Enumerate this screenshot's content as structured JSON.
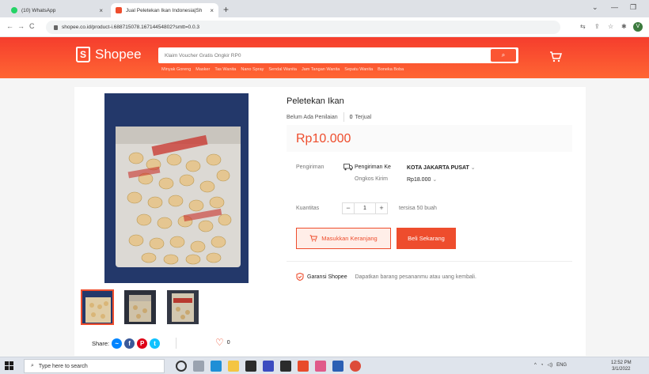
{
  "browser": {
    "tabs": [
      {
        "label": "(10) WhatsApp",
        "icon": "whatsapp-icon",
        "color": "#25d366"
      },
      {
        "label": "Jual Peletekan Ikan Indonesia|Sh",
        "icon": "shopee-bag-icon",
        "color": "#ee4d2d"
      }
    ],
    "url": "shopee.co.id/product-i.688715078.16714454802?smtt=0.0.3",
    "profile_initial": "V"
  },
  "header": {
    "logo_text": "Shopee",
    "search_placeholder": "Klaim Voucher Gratis Ongkir RP0",
    "suggestions": [
      "Minyak Goreng",
      "Masker",
      "Tas Wanita",
      "Nano Spray",
      "Sendal Wanita",
      "Jam Tangan Wanita",
      "Sepatu Wanita",
      "Boneka Boba"
    ],
    "accent": "#ee4d2d"
  },
  "product": {
    "title": "Peletekan Ikan",
    "rating_text": "Belum Ada Penilaian",
    "sold_count": "0",
    "sold_label": "Terjual",
    "price": "Rp10.000",
    "shipping_label": "Pengiriman",
    "shipping_to_label": "Pengiriman Ke",
    "shipping_city": "KOTA JAKARTA PUSAT",
    "shipping_cost_label": "Ongkos Kirim",
    "shipping_cost": "Rp18.000",
    "quantity_label": "Kuantitas",
    "quantity_value": "1",
    "stock_text": "tersisa 50 buah",
    "add_to_cart_label": "Masukkan Keranjang",
    "buy_now_label": "Beli Sekarang",
    "guarantee_title": "Garansi Shopee",
    "guarantee_desc": "Dapatkan barang pesananmu atau uang kembali.",
    "share_label": "Share:",
    "likes": "0"
  },
  "taskbar": {
    "search_placeholder": "Type here to search",
    "lang": "ENG",
    "time": "12:52 PM",
    "date": "3/1/2022"
  }
}
